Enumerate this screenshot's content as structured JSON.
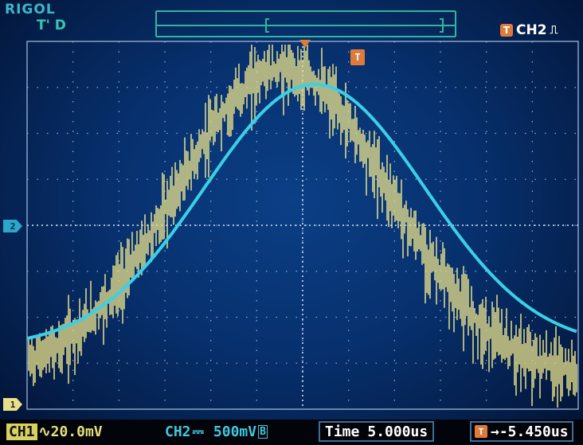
{
  "header": {
    "brand": "RIGOL",
    "trigger_state": "T' D",
    "trigger_badge": {
      "icon": "trigger-T-icon",
      "source": "CH2",
      "edge_icon": "rising-edge-icon"
    },
    "memory_bar_marker": "T"
  },
  "markers": {
    "ch2_ground": "2",
    "ch1_ground": "1",
    "trigger_position": "T"
  },
  "status": {
    "ch1_label": "CH1",
    "ch1_coupling_icon": "ac-coupling-icon",
    "ch1_scale": "20.0mV",
    "ch2_label": "CH2",
    "ch2_coupling_icon": "dc-coupling-icon",
    "ch2_scale": "500mV",
    "ch2_bw_icon": "bw-limit-icon",
    "time_label": "Time",
    "time_value": "5.000us",
    "trigger_offset_icon": "trigger-offset-icon",
    "trigger_offset": "-5.450us"
  },
  "colors": {
    "ch1": "#e8e08a",
    "ch2": "#3ad0e8",
    "trigger": "#e07a3a",
    "grid": "#9fb8d8",
    "background": "#07306d"
  }
}
